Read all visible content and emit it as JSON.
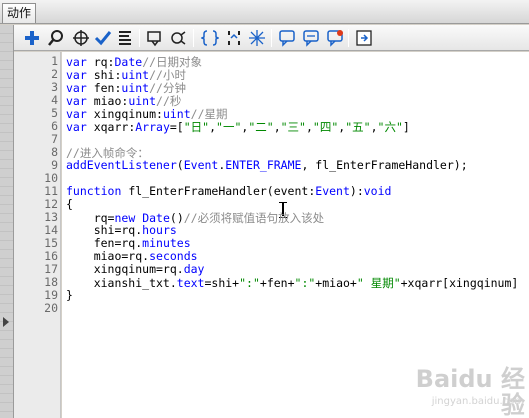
{
  "panel": {
    "tab_label": "动作"
  },
  "toolbar": {
    "buttons": [
      {
        "icon": "add-script-icon"
      },
      {
        "icon": "find-icon"
      },
      {
        "icon": "target-icon"
      },
      {
        "icon": "check-syntax-icon"
      },
      {
        "icon": "auto-format-icon"
      },
      {
        "icon": "code-hint-icon"
      },
      {
        "icon": "debug-options-icon"
      },
      {
        "icon": "collapse-between-braces-icon"
      },
      {
        "icon": "collapse-selection-icon"
      },
      {
        "icon": "expand-all-icon"
      },
      {
        "icon": "apply-block-comment-icon"
      },
      {
        "icon": "apply-line-comment-icon"
      },
      {
        "icon": "remove-comment-icon"
      },
      {
        "icon": "show-hide-toolbox-icon"
      }
    ]
  },
  "editor": {
    "line_numbers": [
      "1",
      "2",
      "3",
      "4",
      "5",
      "6",
      "7",
      "8",
      "9",
      "10",
      "11",
      "12",
      "13",
      "14",
      "15",
      "16",
      "17",
      "18",
      "19",
      "20"
    ],
    "lines": [
      [
        {
          "t": "kw",
          "v": "var"
        },
        {
          "t": "pl",
          "v": " rq:"
        },
        {
          "t": "cl",
          "v": "Date"
        },
        {
          "t": "cm",
          "v": "//日期对象"
        }
      ],
      [
        {
          "t": "kw",
          "v": "var"
        },
        {
          "t": "pl",
          "v": " shi:"
        },
        {
          "t": "cl",
          "v": "uint"
        },
        {
          "t": "cm",
          "v": "//小时"
        }
      ],
      [
        {
          "t": "kw",
          "v": "var"
        },
        {
          "t": "pl",
          "v": " fen:"
        },
        {
          "t": "cl",
          "v": "uint"
        },
        {
          "t": "cm",
          "v": "//分钟"
        }
      ],
      [
        {
          "t": "kw",
          "v": "var"
        },
        {
          "t": "pl",
          "v": " miao:"
        },
        {
          "t": "cl",
          "v": "uint"
        },
        {
          "t": "cm",
          "v": "//秒"
        }
      ],
      [
        {
          "t": "kw",
          "v": "var"
        },
        {
          "t": "pl",
          "v": " xingqinum:"
        },
        {
          "t": "cl",
          "v": "uint"
        },
        {
          "t": "cm",
          "v": "//星期"
        }
      ],
      [
        {
          "t": "kw",
          "v": "var"
        },
        {
          "t": "pl",
          "v": " xqarr:"
        },
        {
          "t": "cl",
          "v": "Array"
        },
        {
          "t": "pl",
          "v": "=["
        },
        {
          "t": "st",
          "v": "\"日\""
        },
        {
          "t": "pl",
          "v": ","
        },
        {
          "t": "st",
          "v": "\"一\""
        },
        {
          "t": "pl",
          "v": ","
        },
        {
          "t": "st",
          "v": "\"二\""
        },
        {
          "t": "pl",
          "v": ","
        },
        {
          "t": "st",
          "v": "\"三\""
        },
        {
          "t": "pl",
          "v": ","
        },
        {
          "t": "st",
          "v": "\"四\""
        },
        {
          "t": "pl",
          "v": ","
        },
        {
          "t": "st",
          "v": "\"五\""
        },
        {
          "t": "pl",
          "v": ","
        },
        {
          "t": "st",
          "v": "\"六\""
        },
        {
          "t": "pl",
          "v": "]"
        }
      ],
      [],
      [
        {
          "t": "cm",
          "v": "//进入帧命令："
        }
      ],
      [
        {
          "t": "cl",
          "v": "addEventListener"
        },
        {
          "t": "pl",
          "v": "("
        },
        {
          "t": "cl",
          "v": "Event"
        },
        {
          "t": "pl",
          "v": "."
        },
        {
          "t": "cl",
          "v": "ENTER_FRAME"
        },
        {
          "t": "pl",
          "v": ", fl_EnterFrameHandler);"
        }
      ],
      [],
      [
        {
          "t": "kw",
          "v": "function"
        },
        {
          "t": "pl",
          "v": " fl_EnterFrameHandler(event:"
        },
        {
          "t": "cl",
          "v": "Event"
        },
        {
          "t": "pl",
          "v": "):"
        },
        {
          "t": "cl",
          "v": "void"
        }
      ],
      [
        {
          "t": "pl",
          "v": "{"
        }
      ],
      [
        {
          "t": "pl",
          "v": "    rq="
        },
        {
          "t": "kw",
          "v": "new"
        },
        {
          "t": "pl",
          "v": " "
        },
        {
          "t": "cl",
          "v": "Date"
        },
        {
          "t": "pl",
          "v": "()"
        },
        {
          "t": "cm",
          "v": "//必须将赋值语句放入该处"
        }
      ],
      [
        {
          "t": "pl",
          "v": "    shi=rq."
        },
        {
          "t": "cl",
          "v": "hours"
        }
      ],
      [
        {
          "t": "pl",
          "v": "    fen=rq."
        },
        {
          "t": "cl",
          "v": "minutes"
        }
      ],
      [
        {
          "t": "pl",
          "v": "    miao=rq."
        },
        {
          "t": "cl",
          "v": "seconds"
        }
      ],
      [
        {
          "t": "pl",
          "v": "    xingqinum=rq."
        },
        {
          "t": "cl",
          "v": "day"
        }
      ],
      [
        {
          "t": "pl",
          "v": "    xianshi_txt."
        },
        {
          "t": "cl",
          "v": "text"
        },
        {
          "t": "pl",
          "v": "=shi+"
        },
        {
          "t": "st",
          "v": "\":\""
        },
        {
          "t": "pl",
          "v": "+fen+"
        },
        {
          "t": "st",
          "v": "\":\""
        },
        {
          "t": "pl",
          "v": "+miao+"
        },
        {
          "t": "st",
          "v": "\" 星期\""
        },
        {
          "t": "pl",
          "v": "+xqarr[xingqinum]"
        }
      ],
      [
        {
          "t": "pl",
          "v": "}"
        }
      ],
      []
    ]
  },
  "watermark": {
    "text": "Baidu 经验",
    "sub": "jingyan.baidu.com"
  },
  "colors": {
    "keyword": "#0000ff",
    "comment": "#8c8c8c",
    "string": "#008800",
    "background": "#ffffff",
    "gutter": "#ebebeb"
  }
}
